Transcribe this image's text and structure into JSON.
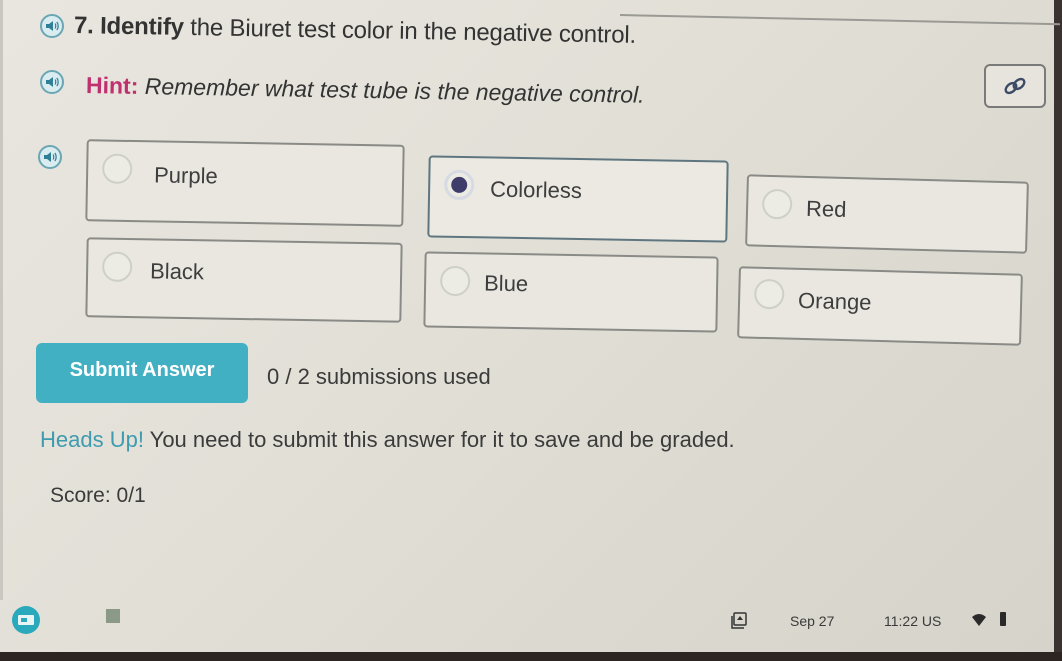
{
  "question": {
    "number": "7.",
    "bold_word": "Identify",
    "rest": " the Biuret test color in the negative control."
  },
  "hint": {
    "label": "Hint:",
    "text": "Remember what test tube is the negative control."
  },
  "link_button": {
    "icon": "link-icon"
  },
  "options": [
    {
      "label": "Purple",
      "selected": false
    },
    {
      "label": "Colorless",
      "selected": true
    },
    {
      "label": "Red",
      "selected": false
    },
    {
      "label": "Black",
      "selected": false
    },
    {
      "label": "Blue",
      "selected": false
    },
    {
      "label": "Orange",
      "selected": false
    }
  ],
  "submit": {
    "label": "Submit Answer",
    "submissions_text": "0 / 2 submissions used"
  },
  "notice": {
    "label": "Heads Up!",
    "text": " You need to submit this answer for it to save and be graded."
  },
  "score": {
    "label": "Score:",
    "value": "0/1"
  },
  "taskbar": {
    "date": "Sep 27",
    "time": "11:22",
    "locale": "US"
  },
  "colors": {
    "accent": "#42b0c3",
    "hint_label": "#c0306e",
    "notice_label": "#3e9bb0",
    "selected_radio": "#3e3c6b"
  }
}
